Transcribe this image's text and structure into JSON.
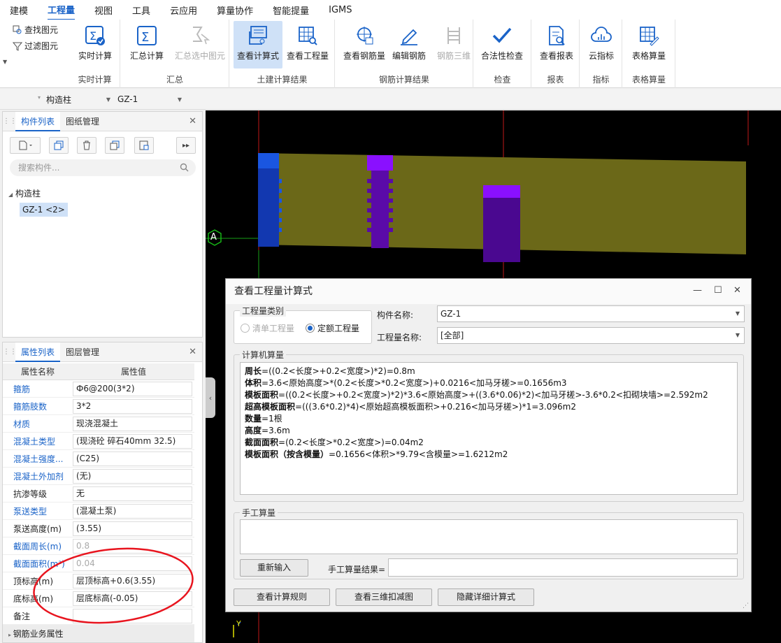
{
  "menu": [
    "建模",
    "工程量",
    "视图",
    "工具",
    "云应用",
    "算量协作",
    "智能提量",
    "IGMS"
  ],
  "ribbon": {
    "find_label": "查找图元",
    "filter_label": "过滤图元",
    "groups": {
      "realtime": "实时计算",
      "summary": "汇总",
      "civil": "土建计算结果",
      "rebar": "钢筋计算结果",
      "check": "检查",
      "report": "报表",
      "index": "指标",
      "table": "表格算量"
    },
    "buttons": {
      "realtime_calc": "实时计算",
      "summary_calc": "汇总计算",
      "summary_selected": "汇总选中图元",
      "view_formula": "查看计算式",
      "view_quantity": "查看工程量",
      "view_rebar": "查看钢筋量",
      "edit_rebar": "编辑钢筋",
      "rebar_3d": "钢筋三维",
      "legality_check": "合法性检查",
      "view_report": "查看报表",
      "cloud_index": "云指标",
      "table_quantity": "表格算量"
    }
  },
  "filter": {
    "type": "构造柱",
    "name": "GZ-1"
  },
  "component_panel": {
    "tabs": [
      "构件列表",
      "图纸管理"
    ],
    "search_placeholder": "搜索构件...",
    "tree_root": "构造柱",
    "tree_item": "GZ-1 <2>"
  },
  "property_panel": {
    "tabs": [
      "属性列表",
      "图层管理"
    ],
    "headers": [
      "属性名称",
      "属性值"
    ],
    "rows": [
      {
        "k": "箍筋",
        "v": "Ф6@200(3*2)"
      },
      {
        "k": "箍筋肢数",
        "v": "3*2"
      },
      {
        "k": "材质",
        "v": "现浇混凝土"
      },
      {
        "k": "混凝土类型",
        "v": "(现浇砼 碎石40mm 32.5)"
      },
      {
        "k": "混凝土强度...",
        "v": "(C25)"
      },
      {
        "k": "混凝土外加剂",
        "v": "(无)"
      },
      {
        "k": "抗渗等级",
        "v": "无"
      },
      {
        "k": "泵送类型",
        "v": "(混凝土泵)"
      },
      {
        "k": "泵送高度(m)",
        "v": "(3.55)"
      },
      {
        "k": "截面周长(m)",
        "v": "0.8"
      },
      {
        "k": "截面面积(m²)",
        "v": "0.04"
      },
      {
        "k": "顶标高(m)",
        "v": "层顶标高+0.6(3.55)"
      },
      {
        "k": "底标高(m)",
        "v": "层底标高(-0.05)"
      },
      {
        "k": "备注",
        "v": ""
      }
    ],
    "section": "钢筋业务属性"
  },
  "viewport": {
    "axis_label": "A",
    "y_label": "Y"
  },
  "dialog": {
    "title": "查看工程量计算式",
    "category_legend": "工程量类别",
    "radio_list": "清单工程量",
    "radio_quota": "定额工程量",
    "component_name_label": "构件名称:",
    "component_name": "GZ-1",
    "quantity_name_label": "工程量名称:",
    "quantity_name": "[全部]",
    "calc_legend": "计算机算量",
    "calc_lines": [
      {
        "b": "周长",
        "t": "=((0.2<长度>+0.2<宽度>)*2)=0.8m"
      },
      {
        "b": "体积",
        "t": "=3.6<原始高度>*(0.2<长度>*0.2<宽度>)+0.0216<加马牙槎>=0.1656m3"
      },
      {
        "b": "模板面积",
        "t": "=((0.2<长度>+0.2<宽度>)*2)*3.6<原始高度>+((3.6*0.06)*2)<加马牙槎>-3.6*0.2<扣砌块墙>=2.592m2"
      },
      {
        "b": "超高模板面积",
        "t": "=(((3.6*0.2)*4)<原始超高模板面积>+0.216<加马牙槎>)*1=3.096m2"
      },
      {
        "b": "数量",
        "t": "=1根"
      },
      {
        "b": "高度",
        "t": "=3.6m"
      },
      {
        "b": "截面面积",
        "t": "=(0.2<长度>*0.2<宽度>)=0.04m2"
      },
      {
        "b": "模板面积（按含模量）",
        "t": "=0.1656<体积>*9.79<含模量>=1.6212m2"
      }
    ],
    "manual_legend": "手工算量",
    "reenter": "重新输入",
    "manual_result_label": "手工算量结果=",
    "btn_rules": "查看计算规则",
    "btn_3d": "查看三维扣减图",
    "btn_hide": "隐藏详细计算式"
  },
  "colors": {
    "accent": "#1a63c8",
    "beam": "#6b6818",
    "blue_col": "#1a56e0",
    "purple": "#8a10ff"
  }
}
